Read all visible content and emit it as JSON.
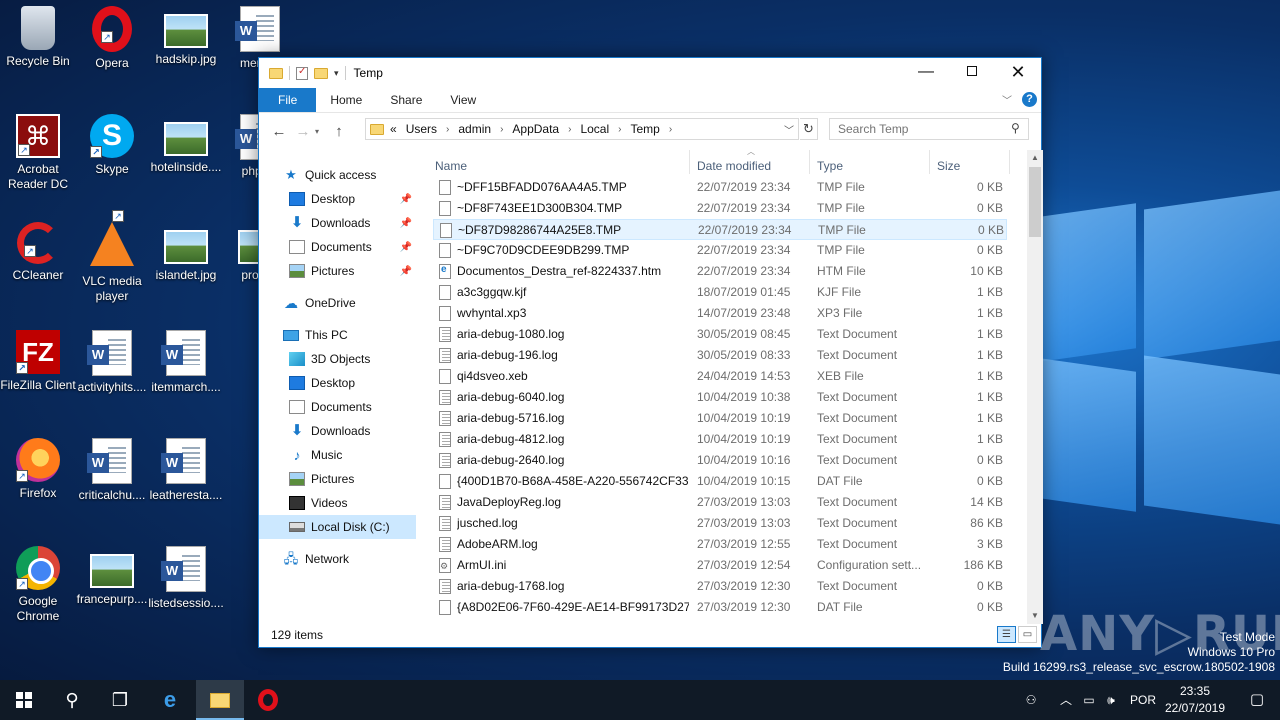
{
  "desktop": {
    "icons": [
      {
        "label": "Recycle Bin",
        "icon": "recycle-bin-icon"
      },
      {
        "label": "Opera",
        "icon": "opera-icon"
      },
      {
        "label": "hadskip.jpg",
        "icon": "image-file-icon"
      },
      {
        "label": "menu...",
        "icon": "word-doc-icon"
      },
      {
        "label": "Acrobat Reader DC",
        "icon": "acrobat-icon"
      },
      {
        "label": "Skype",
        "icon": "skype-icon"
      },
      {
        "label": "hotelinside....",
        "icon": "image-file-icon"
      },
      {
        "label": "phpd...",
        "icon": "word-doc-icon"
      },
      {
        "label": "CCleaner",
        "icon": "ccleaner-icon"
      },
      {
        "label": "VLC media player",
        "icon": "vlc-icon"
      },
      {
        "label": "islandet.jpg",
        "icon": "image-file-icon"
      },
      {
        "label": "progr...",
        "icon": "image-file-icon"
      },
      {
        "label": "FileZilla Client",
        "icon": "filezilla-icon"
      },
      {
        "label": "activityhits....",
        "icon": "word-doc-icon"
      },
      {
        "label": "itemmarch....",
        "icon": "word-doc-icon"
      },
      {
        "label": "Firefox",
        "icon": "firefox-icon"
      },
      {
        "label": "criticalchu....",
        "icon": "word-doc-icon"
      },
      {
        "label": "leatheresta....",
        "icon": "word-doc-icon"
      },
      {
        "label": "Google Chrome",
        "icon": "chrome-icon"
      },
      {
        "label": "francepurp....",
        "icon": "image-file-icon"
      },
      {
        "label": "listedsessio....",
        "icon": "word-doc-icon"
      }
    ]
  },
  "window": {
    "title": "Temp",
    "ribbon_tabs": [
      "File",
      "Home",
      "Share",
      "View"
    ],
    "breadcrumb": [
      "«",
      "Users",
      "admin",
      "AppData",
      "Local",
      "Temp"
    ],
    "search_placeholder": "Search Temp",
    "columns": {
      "name": "Name",
      "date": "Date modified",
      "type": "Type",
      "size": "Size"
    },
    "status": "129 items",
    "nav": {
      "quick_access": "Quick access",
      "qa_items": [
        "Desktop",
        "Downloads",
        "Documents",
        "Pictures"
      ],
      "onedrive": "OneDrive",
      "this_pc": "This PC",
      "pc_items": [
        "3D Objects",
        "Desktop",
        "Documents",
        "Downloads",
        "Music",
        "Pictures",
        "Videos",
        "Local Disk (C:)"
      ],
      "network": "Network"
    },
    "files": [
      {
        "name": "~DFF15BFADD076AA4A5.TMP",
        "date": "22/07/2019 23:34",
        "type": "TMP File",
        "size": "0 KB",
        "icon": "blank"
      },
      {
        "name": "~DF8F743EE1D300B304.TMP",
        "date": "22/07/2019 23:34",
        "type": "TMP File",
        "size": "0 KB",
        "icon": "blank"
      },
      {
        "name": "~DF87D98286744A25E8.TMP",
        "date": "22/07/2019 23:34",
        "type": "TMP File",
        "size": "0 KB",
        "icon": "blank",
        "selected": true
      },
      {
        "name": "~DF9C70D9CDEE9DB299.TMP",
        "date": "22/07/2019 23:34",
        "type": "TMP File",
        "size": "0 KB",
        "icon": "blank"
      },
      {
        "name": "Documentos_Destra_ref-8224337.htm",
        "date": "22/07/2019 23:34",
        "type": "HTM File",
        "size": "10 KB",
        "icon": "htm"
      },
      {
        "name": "a3c3ggqw.kjf",
        "date": "18/07/2019 01:45",
        "type": "KJF File",
        "size": "1 KB",
        "icon": "blank"
      },
      {
        "name": "wvhyntal.xp3",
        "date": "14/07/2019 23:48",
        "type": "XP3 File",
        "size": "1 KB",
        "icon": "blank"
      },
      {
        "name": "aria-debug-1080.log",
        "date": "30/05/2019 08:45",
        "type": "Text Document",
        "size": "1 KB",
        "icon": "lines"
      },
      {
        "name": "aria-debug-196.log",
        "date": "30/05/2019 08:33",
        "type": "Text Document",
        "size": "1 KB",
        "icon": "lines"
      },
      {
        "name": "qi4dsveo.xeb",
        "date": "24/04/2019 14:53",
        "type": "XEB File",
        "size": "1 KB",
        "icon": "blank"
      },
      {
        "name": "aria-debug-6040.log",
        "date": "10/04/2019 10:38",
        "type": "Text Document",
        "size": "1 KB",
        "icon": "lines"
      },
      {
        "name": "aria-debug-5716.log",
        "date": "10/04/2019 10:19",
        "type": "Text Document",
        "size": "1 KB",
        "icon": "lines"
      },
      {
        "name": "aria-debug-4812.log",
        "date": "10/04/2019 10:19",
        "type": "Text Document",
        "size": "1 KB",
        "icon": "lines"
      },
      {
        "name": "aria-debug-2640.log",
        "date": "10/04/2019 10:16",
        "type": "Text Document",
        "size": "0 KB",
        "icon": "lines"
      },
      {
        "name": "{400D1B70-B68A-458E-A220-556742CF33...",
        "date": "10/04/2019 10:15",
        "type": "DAT File",
        "size": "0 KB",
        "icon": "blank"
      },
      {
        "name": "JavaDeployReg.log",
        "date": "27/03/2019 13:03",
        "type": "Text Document",
        "size": "14 KB",
        "icon": "lines"
      },
      {
        "name": "jusched.log",
        "date": "27/03/2019 13:03",
        "type": "Text Document",
        "size": "86 KB",
        "icon": "lines"
      },
      {
        "name": "AdobeARM.log",
        "date": "27/03/2019 12:55",
        "type": "Text Document",
        "size": "3 KB",
        "icon": "lines"
      },
      {
        "name": "ArmUI.ini",
        "date": "27/03/2019 12:54",
        "type": "Configuration sett...",
        "size": "186 KB",
        "icon": "cfg"
      },
      {
        "name": "aria-debug-1768.log",
        "date": "27/03/2019 12:30",
        "type": "Text Document",
        "size": "0 KB",
        "icon": "lines"
      },
      {
        "name": "{A8D02E06-7F60-429E-AE14-BF99173D27...",
        "date": "27/03/2019 12:30",
        "type": "DAT File",
        "size": "0 KB",
        "icon": "blank"
      }
    ]
  },
  "watermark": {
    "text": "ANY▷RUN",
    "mode": "Test Mode",
    "os": "Windows 10 Pro",
    "build": "Build 16299.rs3_release_svc_escrow.180502-1908"
  },
  "taskbar": {
    "language": "POR",
    "time": "23:35",
    "date": "22/07/2019"
  }
}
